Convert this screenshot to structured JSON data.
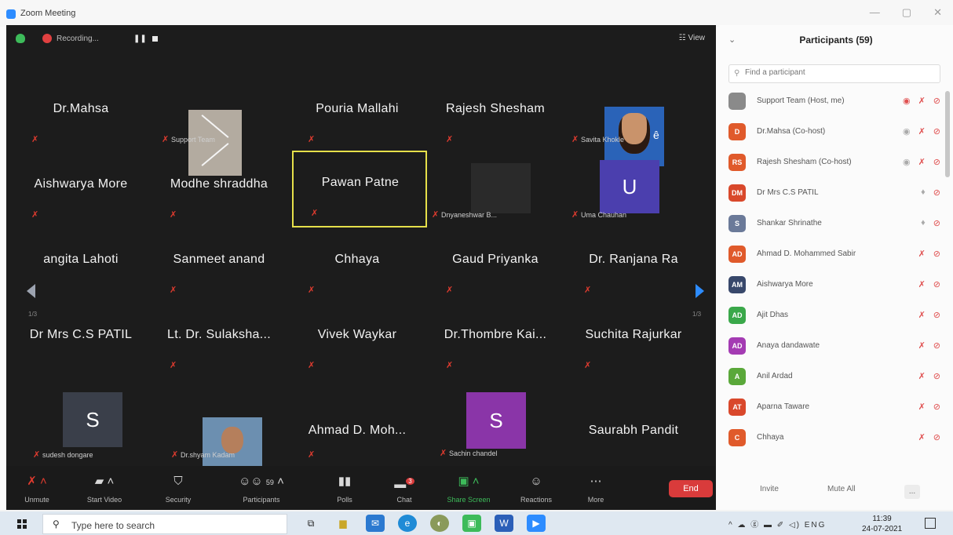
{
  "window": {
    "title": "Zoom Meeting",
    "controls": [
      "—",
      "▢",
      "✕"
    ]
  },
  "topbar": {
    "recording_label": "Recording...",
    "pause_label": "❚❚",
    "view_label": "☷ View"
  },
  "tiles": [
    {
      "name": "Dr.Mahsa",
      "tag": ""
    },
    {
      "name": "",
      "tag": "Support Team"
    },
    {
      "name": "Pouria Mallahi",
      "tag": ""
    },
    {
      "name": "Rajesh Shesham",
      "tag": ""
    },
    {
      "name": "",
      "tag": "Savita Khokle"
    },
    {
      "name": "Aishwarya More",
      "tag": ""
    },
    {
      "name": "Modhe shraddha",
      "tag": ""
    },
    {
      "name": "Pawan Patne",
      "tag": ""
    },
    {
      "name": "",
      "tag": "Dnyaneshwar B..."
    },
    {
      "name": "",
      "tag": "Uma Chauhan"
    },
    {
      "name": "angita Lahoti",
      "tag": ""
    },
    {
      "name": "Sanmeet anand",
      "tag": ""
    },
    {
      "name": "Chhaya",
      "tag": ""
    },
    {
      "name": "Gaud Priyanka",
      "tag": ""
    },
    {
      "name": "Dr. Ranjana Ra",
      "tag": ""
    },
    {
      "name": "Dr Mrs C.S PATIL",
      "tag": ""
    },
    {
      "name": "Lt. Dr. Sulaksha...",
      "tag": ""
    },
    {
      "name": "Vivek Waykar",
      "tag": ""
    },
    {
      "name": "Dr.Thombre Kai...",
      "tag": ""
    },
    {
      "name": "Suchita Rajurkar",
      "tag": ""
    },
    {
      "name": "",
      "tag": "sudesh dongare"
    },
    {
      "name": "",
      "tag": "Dr.shyam Kadam"
    },
    {
      "name": "Ahmad D. Moh...",
      "tag": ""
    },
    {
      "name": "",
      "tag": "Sachin chandel"
    },
    {
      "name": "Saurabh Pandit",
      "tag": ""
    }
  ],
  "avatars": {
    "uma": "U",
    "sudesh": "S",
    "sachin": "S",
    "savita_suffix": "ê"
  },
  "pager": {
    "left": "1/3",
    "right": "1/3"
  },
  "toolbar": {
    "unmute": "Unmute",
    "start_video": "Start Video",
    "security": "Security",
    "participants": "Participants",
    "participants_count": "59",
    "polls": "Polls",
    "chat": "Chat",
    "chat_badge": "3",
    "share_screen": "Share Screen",
    "reactions": "Reactions",
    "more": "More",
    "end": "End"
  },
  "panel": {
    "title": "Participants (59)",
    "search_placeholder": "Find a participant",
    "participants": [
      {
        "initials": "",
        "name": "Support Team (Host, me)",
        "color": "#8a8a8a"
      },
      {
        "initials": "D",
        "name": "Dr.Mahsa (Co-host)",
        "color": "#e05a2b"
      },
      {
        "initials": "RS",
        "name": "Rajesh Shesham (Co-host)",
        "color": "#e05a2b"
      },
      {
        "initials": "DM",
        "name": "Dr Mrs C.S PATIL",
        "color": "#d9482b"
      },
      {
        "initials": "S",
        "name": "Shankar Shrinathe",
        "color": "#6b7a99"
      },
      {
        "initials": "AD",
        "name": "Ahmad D. Mohammed Sabir",
        "color": "#e05a2b"
      },
      {
        "initials": "AM",
        "name": "Aishwarya More",
        "color": "#38486b"
      },
      {
        "initials": "AD",
        "name": "Ajit Dhas",
        "color": "#3aa84a"
      },
      {
        "initials": "AD",
        "name": "Anaya dandawate",
        "color": "#a43bb3"
      },
      {
        "initials": "A",
        "name": "Anil Ardad",
        "color": "#5aa83a"
      },
      {
        "initials": "AT",
        "name": "Aparna Taware",
        "color": "#d9482b"
      },
      {
        "initials": "C",
        "name": "Chhaya",
        "color": "#e05a2b"
      }
    ],
    "invite": "Invite",
    "mute_all": "Mute All",
    "more": "..."
  },
  "taskbar": {
    "search_text": "Type here to search",
    "tray_text": "^ ☁ ⓖ ▬ ✐ ◁) ENG",
    "time": "11:39",
    "date": "24-07-2021"
  },
  "colors": {
    "meeting_bg": "#1c1c1c",
    "highlight": "#e6e04a",
    "accent": "#2d8cff",
    "end": "#d93b3b",
    "uma_avatar": "#4b3fae",
    "sachin_avatar": "#8a35a8",
    "sudesh_avatar": "#3a3f4a"
  }
}
